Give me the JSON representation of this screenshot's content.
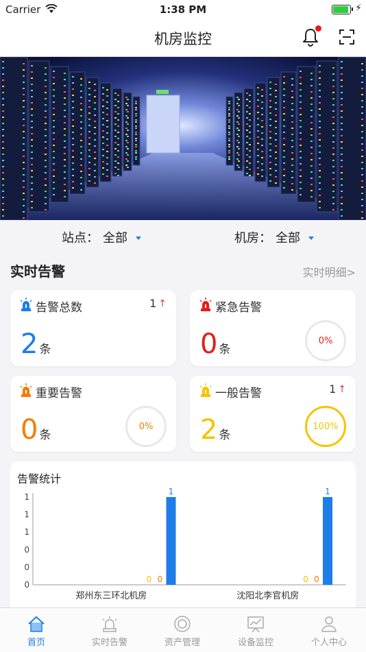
{
  "status_bar": {
    "carrier": "Carrier",
    "time": "1:38 PM"
  },
  "nav": {
    "title": "机房监控"
  },
  "filters": {
    "site_label": "站点：",
    "site_value": "全部",
    "room_label": "机房：",
    "room_value": "全部"
  },
  "section": {
    "title": "实时告警",
    "link": "实时明细>"
  },
  "cards": [
    {
      "title": "告警总数",
      "count": "1",
      "value": "2",
      "unit": "条",
      "color": "#1e7de8"
    },
    {
      "title": "紧急告警",
      "value": "0",
      "unit": "条",
      "percent": "0%",
      "percent_fraction": 0,
      "color": "#e31d1d"
    },
    {
      "title": "重要告警",
      "value": "0",
      "unit": "条",
      "percent": "0%",
      "percent_fraction": 0,
      "color": "#f57c00"
    },
    {
      "title": "一般告警",
      "count": "1",
      "value": "2",
      "unit": "条",
      "percent": "100%",
      "percent_fraction": 1,
      "color": "#f5c400"
    }
  ],
  "chart_title": "告警统计",
  "chart_data": {
    "type": "bar",
    "categories": [
      "郑州东三环北机房",
      "沈阳北李官机房"
    ],
    "series": [
      {
        "values": [
          0,
          0
        ],
        "color": "#f5c400"
      },
      {
        "values": [
          0,
          0
        ],
        "color": "#f57c00"
      },
      {
        "values": [
          1,
          1
        ],
        "color": "#1e7de8"
      }
    ],
    "y_tick_labels": [
      "0",
      "0",
      "0",
      "1",
      "1",
      "1"
    ],
    "ylim": [
      0,
      1
    ],
    "grid": false
  },
  "tabs": [
    {
      "label": "首页",
      "icon": "home-icon",
      "active": true
    },
    {
      "label": "实时告警",
      "icon": "alarm-icon",
      "active": false
    },
    {
      "label": "资产管理",
      "icon": "asset-icon",
      "active": false
    },
    {
      "label": "设备监控",
      "icon": "monitor-icon",
      "active": false
    },
    {
      "label": "个人中心",
      "icon": "person-icon",
      "active": false
    }
  ]
}
